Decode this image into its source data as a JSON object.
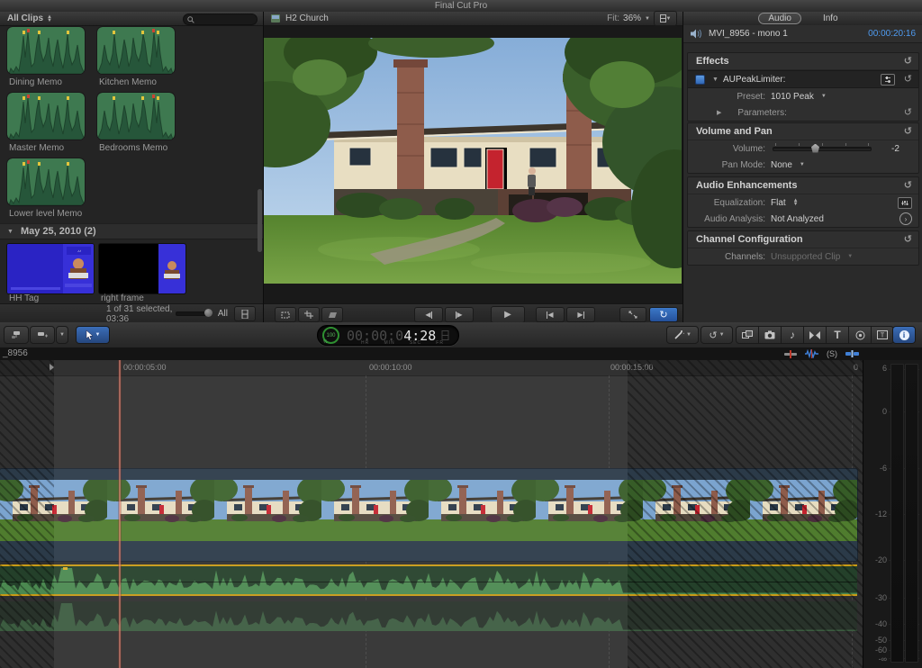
{
  "app": {
    "title": "Final Cut Pro"
  },
  "browser": {
    "filter_label": "All Clips",
    "search_placeholder": "",
    "audio_clips": [
      {
        "label": "Dining Memo"
      },
      {
        "label": "Kitchen Memo"
      },
      {
        "label": "Master Memo"
      },
      {
        "label": "Bedrooms Memo"
      },
      {
        "label": "Lower level Memo"
      }
    ],
    "section_header": "May 25, 2010  (2)",
    "video_clips": [
      {
        "label": "HH Tag"
      },
      {
        "label": "right frame"
      }
    ],
    "status_text": "1 of 31 selected, 03:36",
    "duration_all_label": "All"
  },
  "viewer": {
    "title": "H2 Church",
    "fit_label": "Fit:",
    "zoom_value": "36%"
  },
  "inspector": {
    "tabs": [
      {
        "label": "Audio"
      },
      {
        "label": "Info"
      }
    ],
    "clip_name": "MVI_8956 - mono 1",
    "clip_duration": "00:00:20:16",
    "effects": {
      "title": "Effects",
      "effect_name": "AUPeakLimiter:",
      "preset_label": "Preset:",
      "preset_value": "1010 Peak",
      "parameters_label": "Parameters:"
    },
    "volume_pan": {
      "title": "Volume and Pan",
      "volume_label": "Volume:",
      "volume_value": "-2",
      "pan_mode_label": "Pan Mode:",
      "pan_mode_value": "None"
    },
    "audio_enhancements": {
      "title": "Audio Enhancements",
      "equalization_label": "Equalization:",
      "equalization_value": "Flat",
      "analysis_label": "Audio Analysis:",
      "analysis_value": "Not Analyzed"
    },
    "channel_configuration": {
      "title": "Channel Configuration",
      "channels_label": "Channels:",
      "channels_value": "Unsupported Clip"
    }
  },
  "toolbar": {
    "timecode": {
      "dial_value": "100",
      "dial_unit": "%",
      "dim_digits": "00:00:0",
      "bright_digits": "4:28",
      "units": [
        "HR",
        "MIN",
        "SEC",
        "FR"
      ]
    }
  },
  "timeline": {
    "project_tab_label": "_8956",
    "ruler_labels": [
      {
        "label": "00:00:05:00"
      },
      {
        "label": "00:00:10:00"
      },
      {
        "label": "00:00:15:00"
      },
      {
        "label": "0"
      }
    ],
    "solo_icon_label": "(S)",
    "meter_scale": [
      "6",
      "0",
      "-6",
      "-12",
      "-20",
      "-30",
      "-40",
      "-50",
      "-60",
      "-∞"
    ]
  },
  "colors": {
    "accent_blue": "#3a78c2",
    "selection_yellow": "#c79a16",
    "timecode_blue": "#4f9bf0",
    "waveform_green": "#4b8950"
  }
}
